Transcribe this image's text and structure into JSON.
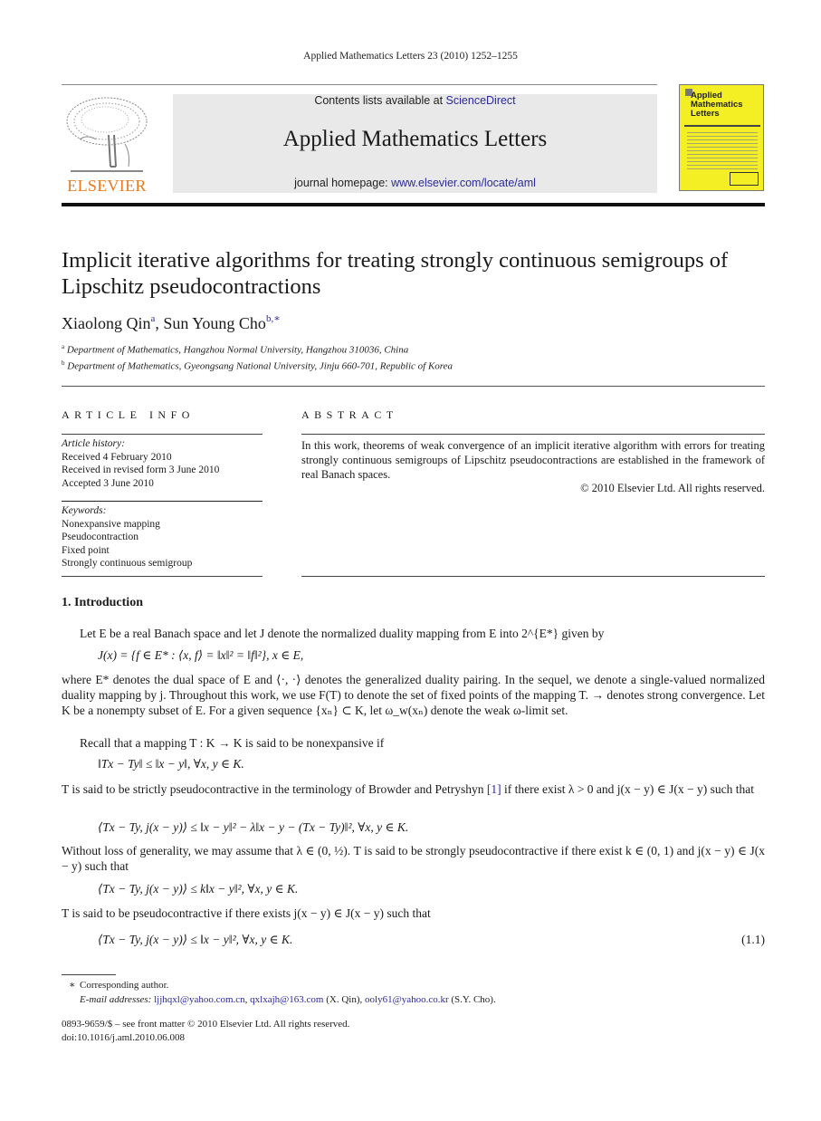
{
  "running_head": "Applied Mathematics Letters 23 (2010) 1252–1255",
  "masthead": {
    "contents_prefix": "Contents lists available at ",
    "contents_link": "ScienceDirect",
    "journal_title": "Applied Mathematics Letters",
    "homepage_prefix": "journal homepage: ",
    "homepage_link": "www.elsevier.com/locate/aml",
    "publisher_logo_text": "ELSEVIER",
    "cover_title_lines": [
      "Applied",
      "Mathematics",
      "Letters"
    ]
  },
  "article": {
    "title": "Implicit iterative algorithms for treating strongly continuous semigroups of Lipschitz pseudocontractions",
    "authors": [
      {
        "name": "Xiaolong Qin",
        "sup": "a"
      },
      {
        "name": "Sun Young Cho",
        "sup": "b,∗"
      }
    ],
    "author_separator": ", ",
    "affiliations": [
      {
        "mark": "a",
        "text": "Department of Mathematics, Hangzhou Normal University, Hangzhou 310036, China"
      },
      {
        "mark": "b",
        "text": "Department of Mathematics, Gyeongsang National University, Jinju 660-701, Republic of Korea"
      }
    ]
  },
  "article_info": {
    "heading": "ARTICLE INFO",
    "history_label": "Article history:",
    "history": [
      "Received 4 February 2010",
      "Received in revised form 3 June 2010",
      "Accepted 3 June 2010"
    ],
    "keywords_label": "Keywords:",
    "keywords": [
      "Nonexpansive mapping",
      "Pseudocontraction",
      "Fixed point",
      "Strongly continuous semigroup"
    ]
  },
  "abstract": {
    "heading": "ABSTRACT",
    "text": "In this work, theorems of weak convergence of an implicit iterative algorithm with errors for treating strongly continuous semigroups of Lipschitz pseudocontractions are established in the framework of real Banach spaces.",
    "copyright": "© 2010 Elsevier Ltd. All rights reserved."
  },
  "introduction": {
    "heading": "1.  Introduction",
    "p1": "Let E be a real Banach space and let J denote the normalized duality mapping from E into 2^{E*} given by",
    "eq_J": "J(x) = {f ∈ E* : ⟨x, f⟩ = ‖x‖² = ‖f‖²},    x ∈ E,",
    "p2": "where E* denotes the dual space of E and ⟨·, ·⟩ denotes the generalized duality pairing. In the sequel, we denote a single-valued normalized duality mapping by j. Throughout this work, we use F(T) to denote the set of fixed points of the mapping T. → denotes strong convergence. Let K be a nonempty subset of E. For a given sequence {xₙ} ⊂ K, let ω_w(xₙ) denote the weak ω-limit set.",
    "p3": "Recall that a mapping T : K → K is said to be nonexpansive if",
    "eq_nonexp": "‖Tx − Ty‖ ≤ ‖x − y‖,    ∀x, y ∈ K.",
    "p4_a": "T is said to be strictly pseudocontractive in the terminology of Browder and Petryshyn ",
    "p4_ref": "[1]",
    "p4_b": " if there exist λ > 0 and j(x − y) ∈ J(x − y) such that",
    "eq_strict": "⟨Tx − Ty, j(x − y)⟩ ≤ ‖x − y‖² − λ‖x − y − (Tx − Ty)‖²,    ∀x, y ∈ K.",
    "p5": "Without loss of generality, we may assume that λ ∈ (0, ½). T is said to be strongly pseudocontractive if there exist k ∈ (0, 1) and j(x − y) ∈ J(x − y) such that",
    "eq_strong": "⟨Tx − Ty, j(x − y)⟩ ≤ k‖x − y‖²,    ∀x, y ∈ K.",
    "p6": "T is said to be pseudocontractive if there exists j(x − y) ∈ J(x − y) such that",
    "eq_pseudo": "⟨Tx − Ty, j(x − y)⟩ ≤ ‖x − y‖²,    ∀x, y ∈ K.",
    "eq_pseudo_number": "(1.1)"
  },
  "footnotes": {
    "star": "∗",
    "corresponding": "Corresponding author.",
    "email_label": "E-mail addresses:",
    "emails": [
      {
        "address": "ljjhqxl@yahoo.com.cn",
        "suffix": ", "
      },
      {
        "address": "qxlxajh@163.com",
        "suffix": " (X. Qin), "
      },
      {
        "address": "ooly61@yahoo.co.kr",
        "suffix": " (S.Y. Cho)."
      }
    ],
    "front_matter": "0893-9659/$ – see front matter © 2010 Elsevier Ltd. All rights reserved.",
    "doi": "doi:10.1016/j.aml.2010.06.008"
  },
  "colors": {
    "link": "#2a2a9c",
    "elsevier_orange": "#e87b1e",
    "cover_yellow": "#f4ee25",
    "masthead_gray": "#e9e9e9"
  }
}
